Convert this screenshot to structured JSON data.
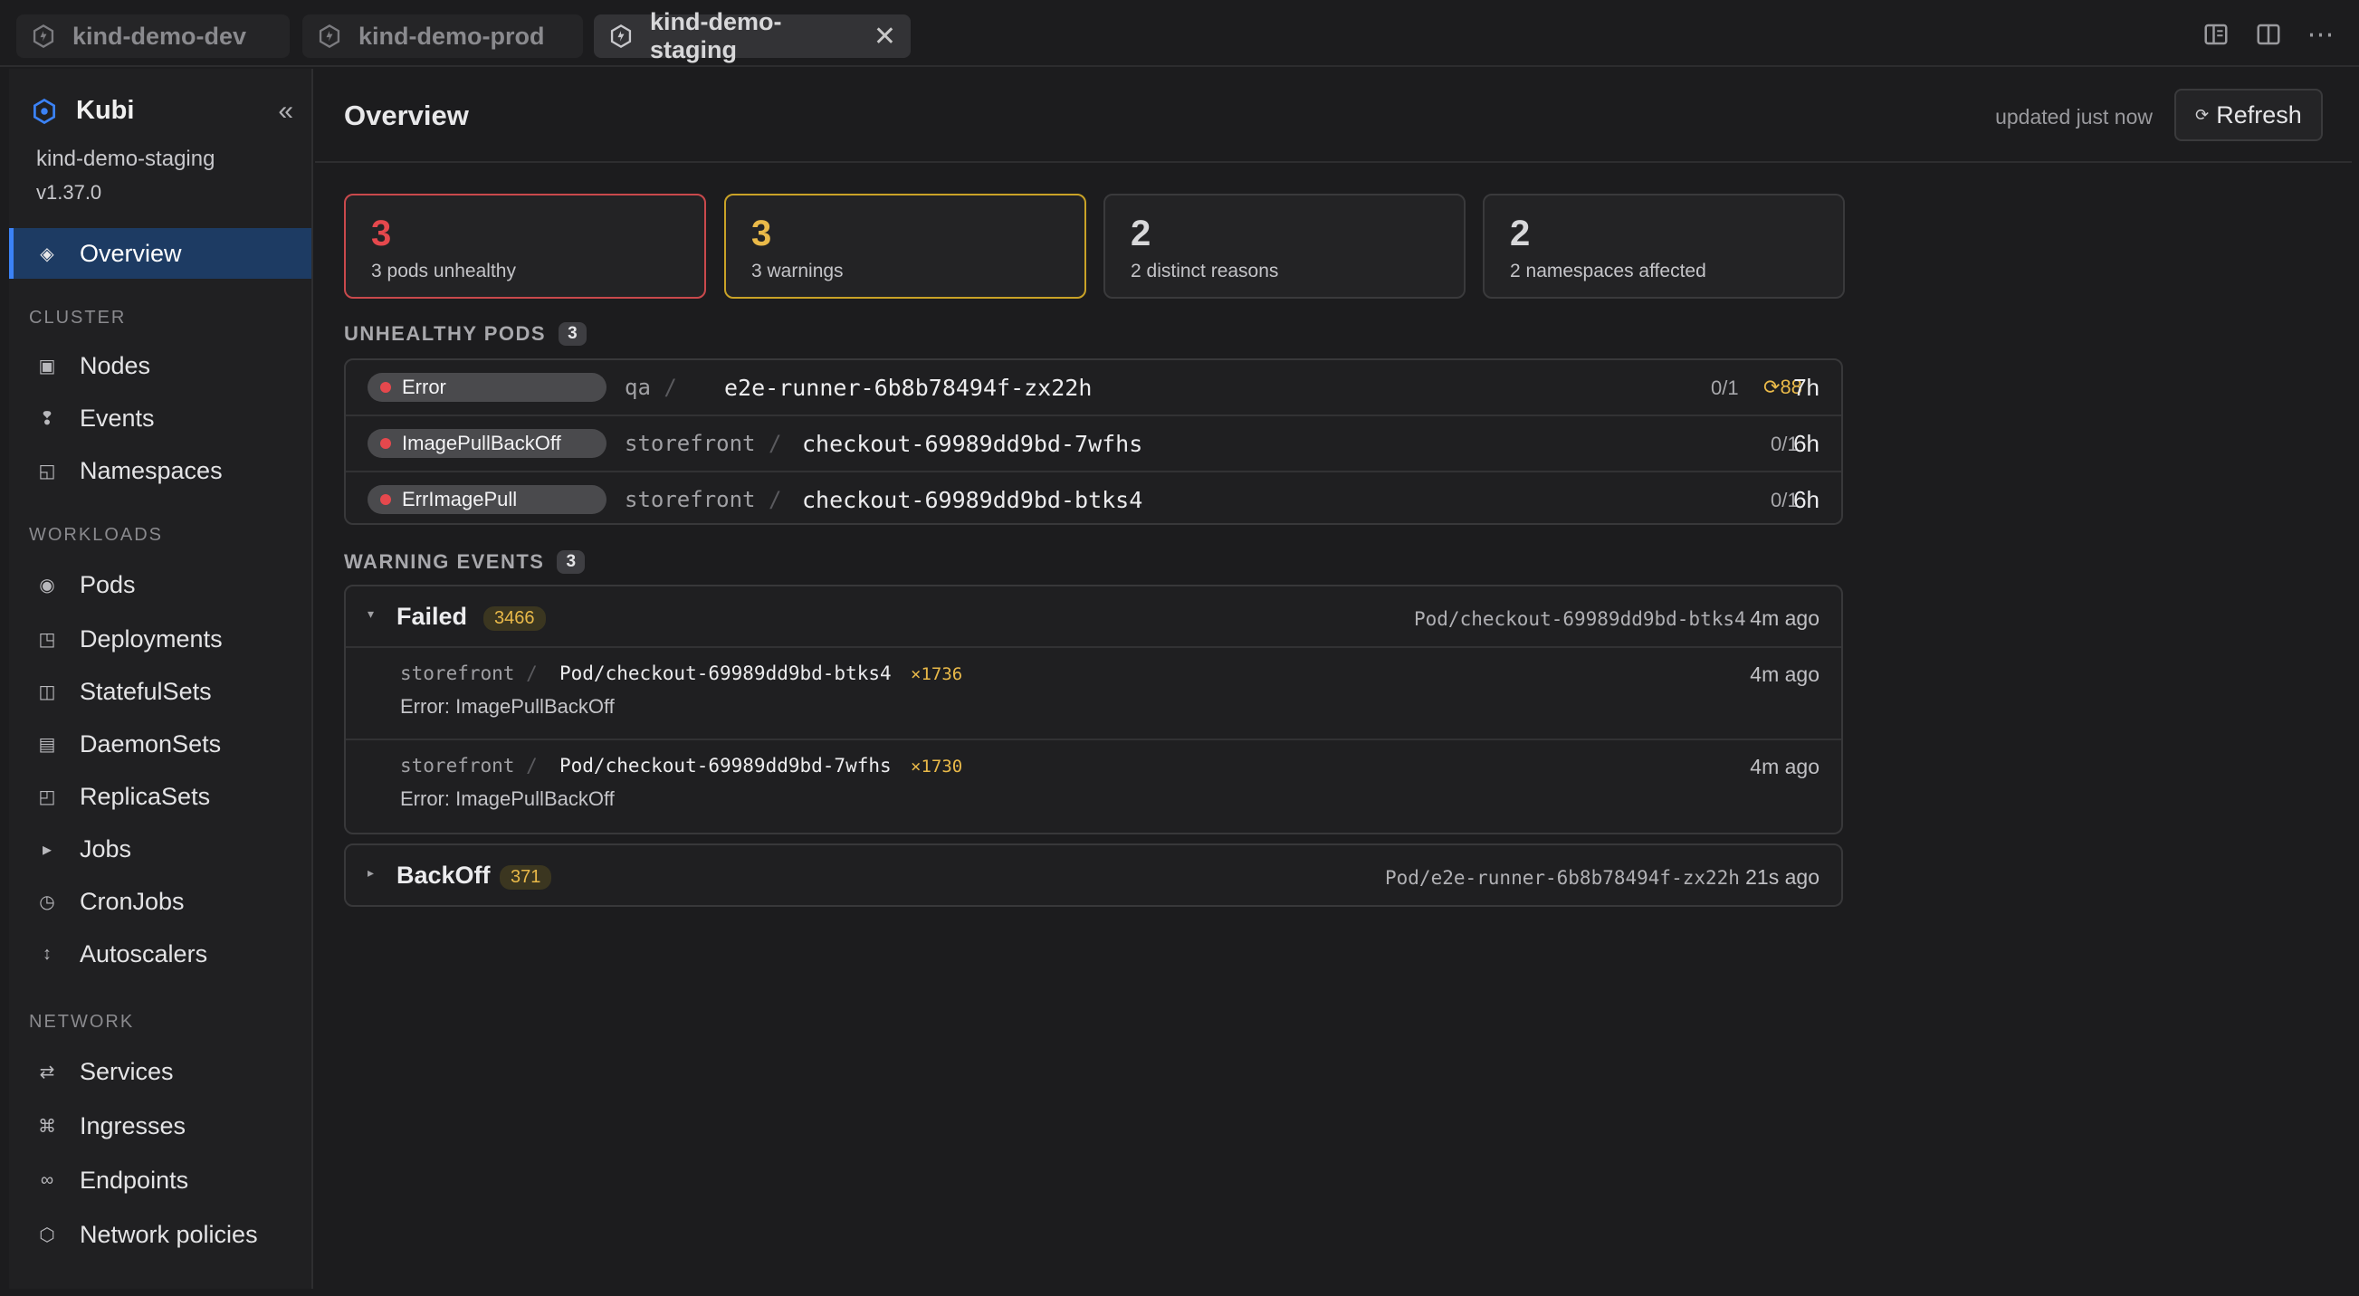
{
  "tabs": [
    {
      "label": "kind-demo-dev",
      "active": false
    },
    {
      "label": "kind-demo-prod",
      "active": false
    },
    {
      "label": "kind-demo-staging",
      "active": true
    }
  ],
  "sidebar": {
    "app_name": "Kubi",
    "context": "kind-demo-staging",
    "version": "v1.37.0",
    "overview": "Overview",
    "sections": {
      "cluster": "CLUSTER",
      "workloads": "WORKLOADS",
      "network": "NETWORK"
    },
    "cluster_items": [
      "Nodes",
      "Events",
      "Namespaces"
    ],
    "workload_items": [
      "Pods",
      "Deployments",
      "StatefulSets",
      "DaemonSets",
      "ReplicaSets",
      "Jobs",
      "CronJobs",
      "Autoscalers"
    ],
    "network_items": [
      "Services",
      "Ingresses",
      "Endpoints",
      "Network policies"
    ]
  },
  "header": {
    "title": "Overview",
    "updated": "updated just now",
    "refresh": "Refresh"
  },
  "cards": [
    {
      "value": "3",
      "label": "3 pods unhealthy",
      "tone": "#e5484d"
    },
    {
      "value": "3",
      "label": "3 warnings",
      "tone": "#e9b949"
    },
    {
      "value": "2",
      "label": "2 distinct reasons"
    },
    {
      "value": "2",
      "label": "2 namespaces affected"
    }
  ],
  "unhealthy": {
    "heading": "UNHEALTHY PODS",
    "count": "3",
    "rows": [
      {
        "status": "Error",
        "namespace": "qa",
        "name": "e2e-runner-6b8b78494f-zx22h",
        "ready": "0/1",
        "restarts": "88",
        "age": "7h"
      },
      {
        "status": "ImagePullBackOff",
        "namespace": "storefront",
        "name": "checkout-69989dd9bd-7wfhs",
        "ready": "0/1",
        "restarts": "",
        "age": "6h"
      },
      {
        "status": "ErrImagePull",
        "namespace": "storefront",
        "name": "checkout-69989dd9bd-btks4",
        "ready": "0/1",
        "restarts": "",
        "age": "6h"
      }
    ]
  },
  "warnings": {
    "heading": "WARNING EVENTS",
    "count": "3",
    "groups": [
      {
        "reason": "Failed",
        "count": "3466",
        "object": "Pod/checkout-69989dd9bd-btks4",
        "ago": "4m ago",
        "expanded": true,
        "events": [
          {
            "namespace": "storefront",
            "object": "Pod/checkout-69989dd9bd-btks4",
            "multiplier": "×1736",
            "message": "Error: ImagePullBackOff",
            "ago": "4m ago"
          },
          {
            "namespace": "storefront",
            "object": "Pod/checkout-69989dd9bd-7wfhs",
            "multiplier": "×1730",
            "message": "Error: ImagePullBackOff",
            "ago": "4m ago"
          }
        ]
      },
      {
        "reason": "BackOff",
        "count": "371",
        "object": "Pod/e2e-runner-6b8b78494f-zx22h",
        "ago": "21s ago",
        "expanded": false
      }
    ]
  },
  "glyphs": {
    "separator": "/",
    "restart_icon": "⟳",
    "caret_down": "▾",
    "caret_right": "▸",
    "collapse": "«",
    "close": "✕",
    "more": "⋯"
  }
}
